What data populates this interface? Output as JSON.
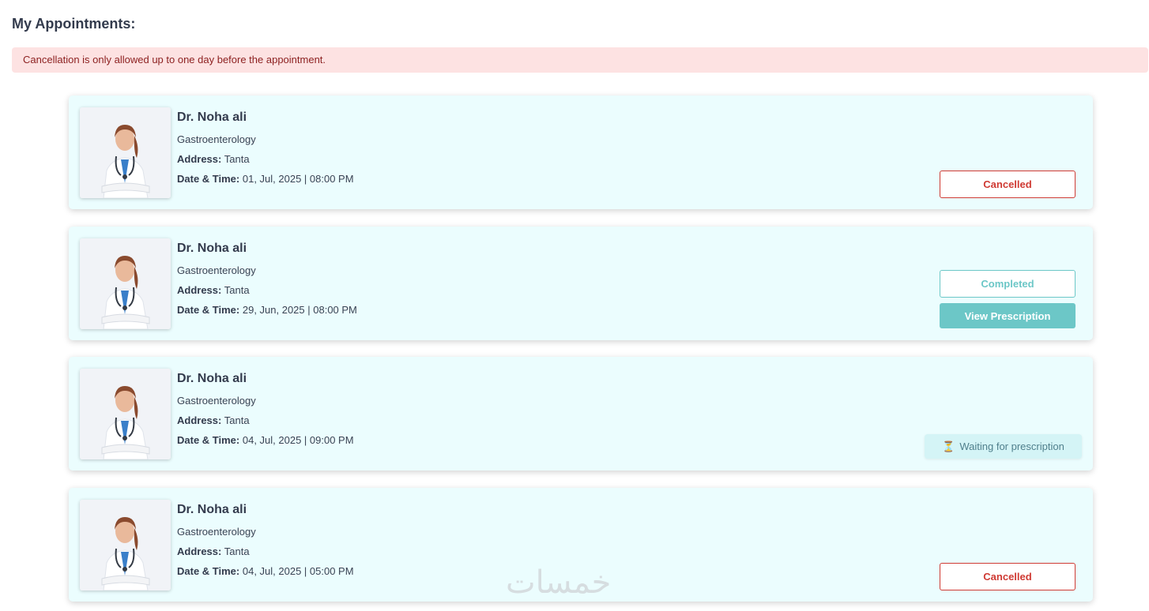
{
  "page": {
    "title": "My Appointments:",
    "notice": "Cancellation is only allowed up to one day before the appointment."
  },
  "labels": {
    "address": "Address:",
    "datetime": "Date & Time:"
  },
  "appointments": [
    {
      "doctor": "Dr. Noha ali",
      "specialty": "Gastroenterology",
      "address": "Tanta",
      "datetime": "01, Jul, 2025 | 08:00 PM",
      "status": "Cancelled"
    },
    {
      "doctor": "Dr. Noha ali",
      "specialty": "Gastroenterology",
      "address": "Tanta",
      "datetime": "29, Jun, 2025 | 08:00 PM",
      "status": "Completed",
      "action": "View Prescription"
    },
    {
      "doctor": "Dr. Noha ali",
      "specialty": "Gastroenterology",
      "address": "Tanta",
      "datetime": "04, Jul, 2025 | 09:00 PM",
      "status": "Waiting for prescription",
      "status_icon": "hourglass-icon"
    },
    {
      "doctor": "Dr. Noha ali",
      "specialty": "Gastroenterology",
      "address": "Tanta",
      "datetime": "04, Jul, 2025 | 05:00 PM",
      "status": "Cancelled"
    }
  ],
  "watermark": "خمسات",
  "colors": {
    "card_bg": "#ebfdfe",
    "notice_bg": "#fde2e2",
    "notice_text": "#8c1f1f",
    "cancelled": "#cf3a33",
    "teal": "#6cc7c7",
    "waiting_bg": "#d4f4f6"
  }
}
